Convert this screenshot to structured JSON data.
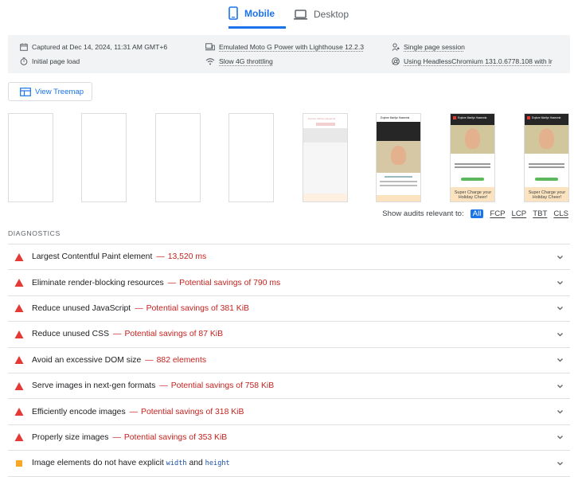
{
  "tabs": {
    "mobile": "Mobile",
    "desktop": "Desktop"
  },
  "env": {
    "captured": "Captured at Dec 14, 2024, 11:31 AM GMT+6",
    "initial_load": "Initial page load",
    "device": "Emulated Moto G Power with Lighthouse 12.2.3",
    "throttling": "Slow 4G throttling",
    "session": "Single page session",
    "browser": "Using HeadlessChromium 131.0.6778.108 with lr"
  },
  "treemap": {
    "label": "View Treemap"
  },
  "thumbs": {
    "site_title": "Explore Marilyn Hasenela",
    "site_title_b": "Explore Marilyn Hasenela",
    "site_title_c": "Explore Marilyn Hasenela",
    "super_text": "Super Charge your Holiday Cheer!",
    "super_text_b": "Super Charge your Holiday Cheer!"
  },
  "filter": {
    "label": "Show audits relevant to:",
    "all": "All",
    "fcp": "FCP",
    "lcp": "LCP",
    "tbt": "TBT",
    "cls": "CLS"
  },
  "section": {
    "title": "DIAGNOSTICS"
  },
  "audits": [
    {
      "title": "Largest Contentful Paint element",
      "dash": "—",
      "value": "13,520 ms",
      "severity": "fail"
    },
    {
      "title": "Eliminate render-blocking resources",
      "dash": "—",
      "value": "Potential savings of 790 ms",
      "severity": "fail"
    },
    {
      "title": "Reduce unused JavaScript",
      "dash": "—",
      "value": "Potential savings of 381 KiB",
      "severity": "fail"
    },
    {
      "title": "Reduce unused CSS",
      "dash": "—",
      "value": "Potential savings of 87 KiB",
      "severity": "fail"
    },
    {
      "title": "Avoid an excessive DOM size",
      "dash": "—",
      "value": "882 elements",
      "severity": "fail"
    },
    {
      "title": "Serve images in next-gen formats",
      "dash": "—",
      "value": "Potential savings of 758 KiB",
      "severity": "fail"
    },
    {
      "title": "Efficiently encode images",
      "dash": "—",
      "value": "Potential savings of 318 KiB",
      "severity": "fail"
    },
    {
      "title": "Properly size images",
      "dash": "—",
      "value": "Potential savings of 353 KiB",
      "severity": "fail"
    }
  ],
  "last_audit": {
    "pre": "Image elements do not have explicit",
    "code1": "width",
    "mid": "and",
    "code2": "height",
    "severity": "average"
  },
  "colors": {
    "accent": "#1a73e8",
    "fail": "#e53935",
    "fail_text": "#c5221f",
    "average": "#f9a825"
  }
}
